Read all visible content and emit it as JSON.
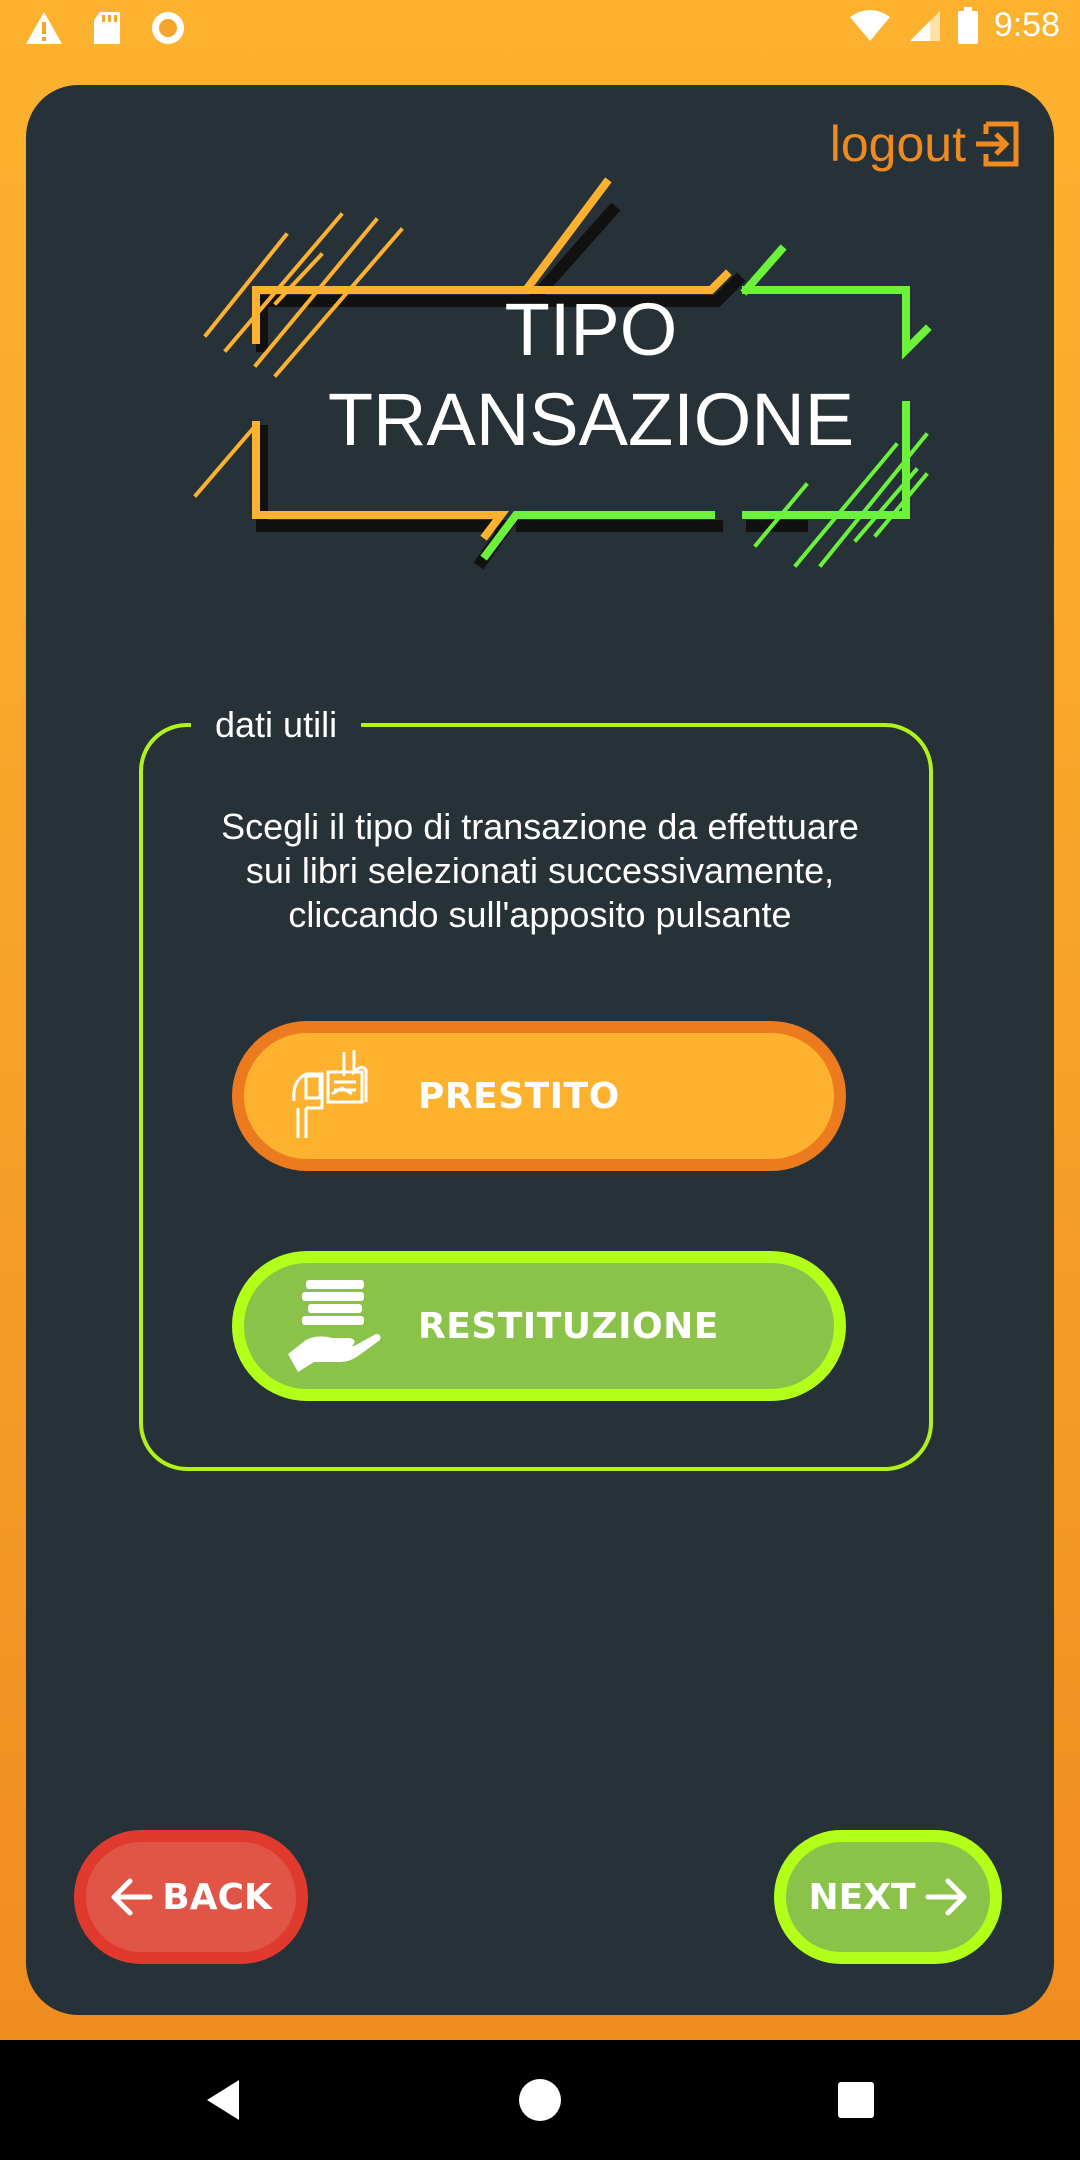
{
  "status_bar": {
    "time": "9:58",
    "icons": [
      "warning-icon",
      "sd-card-icon",
      "circle-record-icon",
      "wifi-icon",
      "cell-signal-icon",
      "battery-icon"
    ]
  },
  "header": {
    "logout_label": "logout",
    "title_line1": "TIPO",
    "title_line2": "TRANSAZIONE"
  },
  "info": {
    "legend": "dati utili",
    "description": [
      "Scegli il tipo di transazione da effettuare",
      "sui libri selezionati successivamente,",
      "cliccando sull'apposito pulsante"
    ],
    "buttons": {
      "prestito": "PRESTITO",
      "restituzione": "RESTITUZIONE"
    }
  },
  "footer": {
    "back_label": "BACK",
    "next_label": "NEXT"
  },
  "colors": {
    "background_top": "#FDB22F",
    "card": "#263238",
    "orange_accent": "#EF8A1E",
    "green_accent": "#B2F21A",
    "green_button": "#8BC34A",
    "red_button": "#E05546"
  }
}
